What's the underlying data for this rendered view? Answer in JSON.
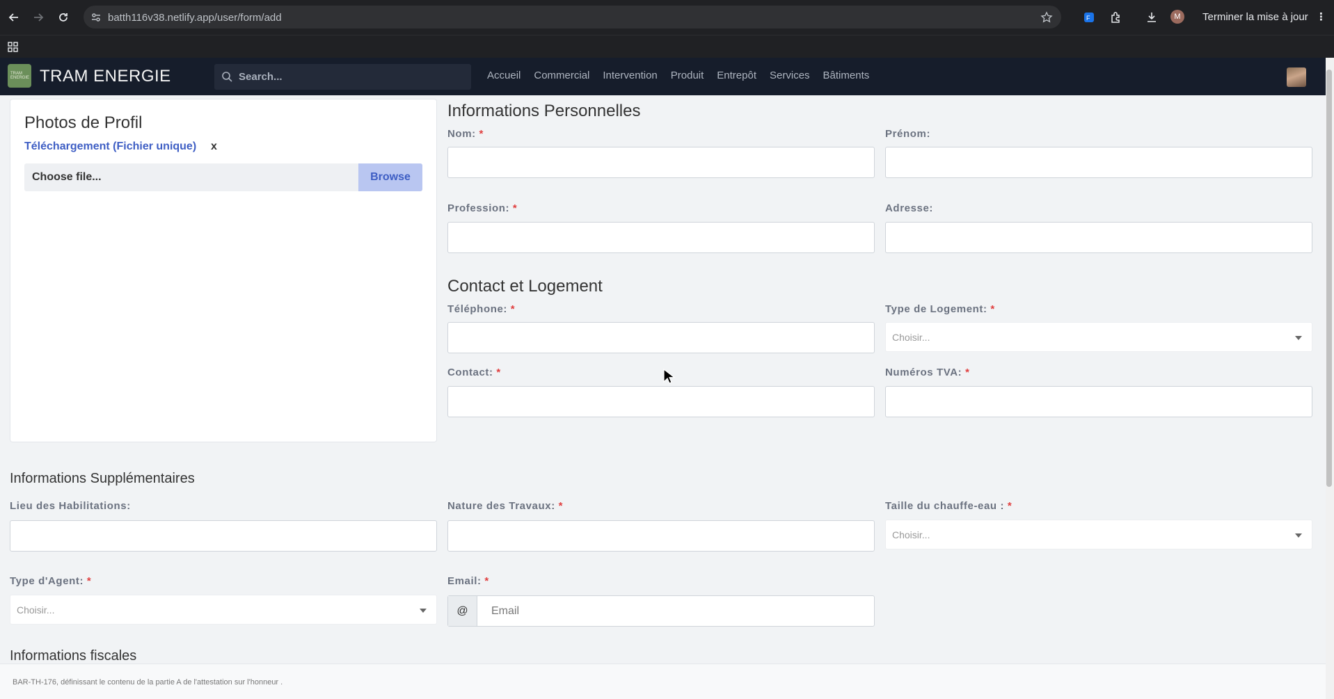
{
  "browser": {
    "url": "batth116v38.netlify.app/user/form/add",
    "profile_initial": "M",
    "update_label": "Terminer la mise à jour"
  },
  "app": {
    "brand": "TRAM ENERGIE",
    "logo_text": "TRAM ENERGIE",
    "search_placeholder": "Search...",
    "nav": [
      "Accueil",
      "Commercial",
      "Intervention",
      "Produit",
      "Entrepôt",
      "Services",
      "Bâtiments"
    ]
  },
  "photo_card": {
    "title": "Photos de Profil",
    "upload_label": "Téléchargement (Fichier unique)",
    "upload_close": "x",
    "file_placeholder": "Choose file...",
    "browse_label": "Browse"
  },
  "personal": {
    "title": "Informations Personnelles",
    "nom": "Nom:",
    "prenom": "Prénom:",
    "profession": "Profession:",
    "adresse": "Adresse:"
  },
  "contact": {
    "title": "Contact et Logement",
    "telephone": "Téléphone:",
    "type_logement": "Type de Logement:",
    "contact": "Contact:",
    "tva": "Numéros TVA:",
    "select_placeholder": "Choisir..."
  },
  "extra": {
    "title": "Informations Supplémentaires",
    "lieu": "Lieu des Habilitations:",
    "nature": "Nature des Travaux:",
    "taille": "Taille du chauffe-eau :",
    "type_agent": "Type d'Agent:",
    "email": "Email:",
    "email_prefix": "@",
    "email_placeholder": "Email",
    "select_placeholder": "Choisir..."
  },
  "fiscal": {
    "title": "Informations fiscales"
  },
  "required_mark": "*",
  "footer": {
    "text": "BAR-TH-176, définissant le contenu de la partie A de l'attestation sur l'honneur ."
  }
}
